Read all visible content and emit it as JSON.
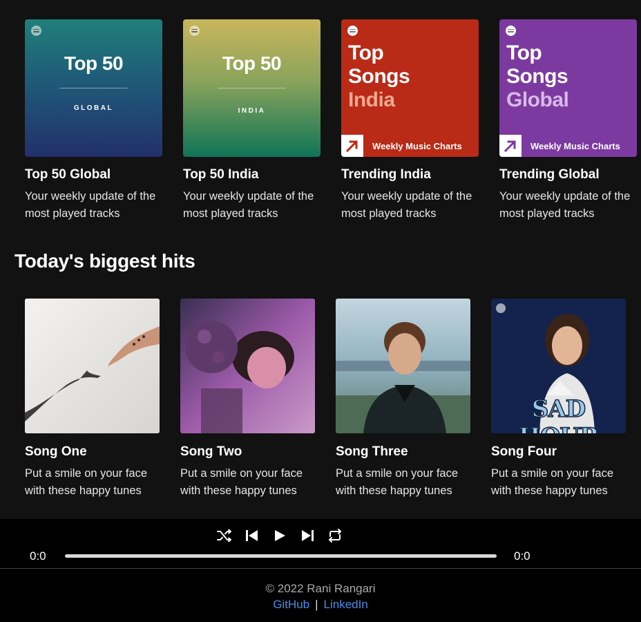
{
  "charts": [
    {
      "art_title": "Top 50",
      "art_sub": "GLOBAL",
      "title": "Top 50 Global",
      "desc": "Your weekly update of the most played tracks"
    },
    {
      "art_title": "Top 50",
      "art_sub": "INDIA",
      "title": "Top 50 India",
      "desc": "Your weekly update of the most played tracks"
    },
    {
      "art_line1": "Top",
      "art_line2": "Songs",
      "art_line3": "India",
      "art_footer": "Weekly Music Charts",
      "title": "Trending India",
      "desc": "Your weekly update of the most played tracks"
    },
    {
      "art_line1": "Top",
      "art_line2": "Songs",
      "art_line3": "Global",
      "art_footer": "Weekly Music Charts",
      "title": "Trending Global",
      "desc": "Your weekly update of the most played tracks"
    }
  ],
  "section_heading": "Today's biggest hits",
  "hits": [
    {
      "title": "Song One",
      "desc": "Put a smile on your face with these happy tunes"
    },
    {
      "title": "Song Two",
      "desc": "Put a smile on your face with these happy tunes"
    },
    {
      "title": "Song Three",
      "desc": "Put a smile on your face with these happy tunes"
    },
    {
      "title": "Song Four",
      "desc": "Put a smile on your face with these happy tunes",
      "art_text": "SAD HOUR"
    }
  ],
  "player": {
    "icons": [
      "shuffle-icon",
      "previous-icon",
      "play-icon",
      "next-icon",
      "repeat-icon"
    ],
    "current_time": "0:0",
    "total_time": "0:0",
    "progress": 0
  },
  "footer": {
    "copyright": "© 2022 Rani Rangari",
    "github": "GitHub",
    "separator": "|",
    "linkedin": "LinkedIn"
  },
  "colors": {
    "background": "#121212",
    "player_bg": "#000000",
    "link": "#4a8ce8",
    "trend_india": "#b92a17",
    "trend_global": "#7c3aa0"
  }
}
